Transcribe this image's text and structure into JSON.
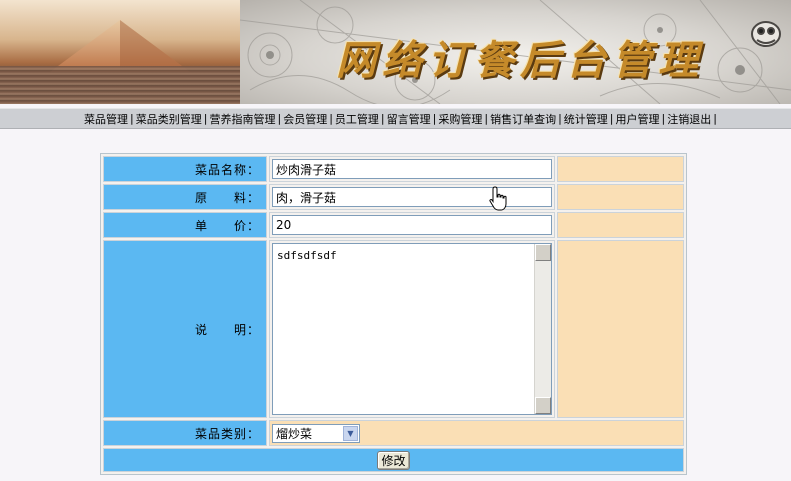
{
  "banner": {
    "title": "网络订餐后台管理"
  },
  "nav": {
    "items": [
      "菜品管理",
      "菜品类别管理",
      "营养指南管理",
      "会员管理",
      "员工管理",
      "留言管理",
      "采购管理",
      "销售订单查询",
      "统计管理",
      "用户管理",
      "注销退出"
    ],
    "separator": "|"
  },
  "form": {
    "name_label": "菜品名称：",
    "name_value": "炒肉滑子菇",
    "ingredients_label": "原　　料：",
    "ingredients_value": "肉，滑子菇",
    "price_label": "单　　价：",
    "price_value": "20",
    "desc_label": "说　　明：",
    "desc_value": "sdfsdfsdf",
    "category_label": "菜品类别：",
    "category_value": "熘炒菜",
    "submit_label": "修改"
  }
}
